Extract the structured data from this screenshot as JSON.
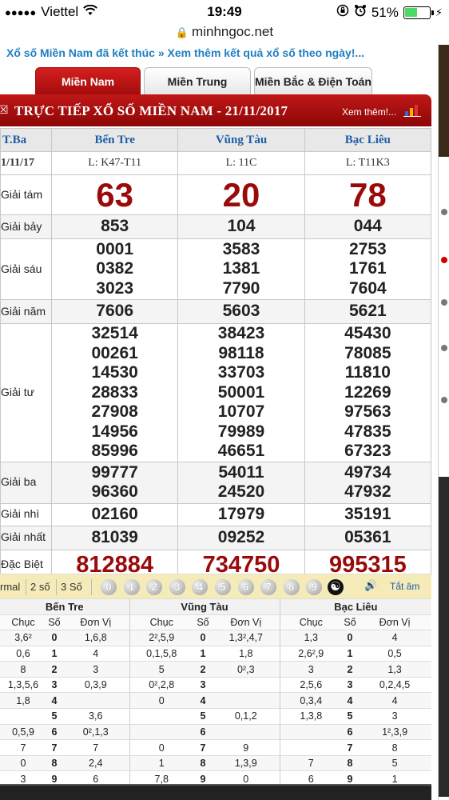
{
  "status_bar": {
    "signal_dots": "●●●●●",
    "carrier": "Viettel",
    "time": "19:49",
    "battery_percent": "51%",
    "battery_level": 0.51
  },
  "url_bar": {
    "domain": "minhngoc.net"
  },
  "marquee": "Xổ số Miền Nam đã kết thúc » Xem thêm kết quả xổ số theo ngày!...",
  "tabs": [
    {
      "label": "Miền Nam",
      "active": true
    },
    {
      "label": "Miền Trung",
      "active": false
    },
    {
      "label": "Miền Bắc & Điện Toán",
      "active": false
    }
  ],
  "header": {
    "title": "TRỰC TIẾP XỔ SỐ MIỀN NAM - 21/11/2017",
    "more_link": "Xem thêm!..."
  },
  "results": {
    "day": "T.Ba",
    "date": "1/11/17",
    "provinces": [
      {
        "name": "Bến Tre",
        "code": "L: K47-T11"
      },
      {
        "name": "Vũng Tàu",
        "code": "L: 11C"
      },
      {
        "name": "Bạc Liêu",
        "code": "L: T11K3"
      }
    ],
    "prizes": [
      {
        "label": "Giải tám",
        "values": [
          [
            "63"
          ],
          [
            "20"
          ],
          [
            "78"
          ]
        ]
      },
      {
        "label": "Giải bảy",
        "values": [
          [
            "853"
          ],
          [
            "104"
          ],
          [
            "044"
          ]
        ]
      },
      {
        "label": "Giải sáu",
        "values": [
          [
            "0001",
            "0382",
            "3023"
          ],
          [
            "3583",
            "1381",
            "7790"
          ],
          [
            "2753",
            "1761",
            "7604"
          ]
        ]
      },
      {
        "label": "Giải năm",
        "values": [
          [
            "7606"
          ],
          [
            "5603"
          ],
          [
            "5621"
          ]
        ]
      },
      {
        "label": "Giải tư",
        "values": [
          [
            "32514",
            "00261",
            "14530",
            "28833",
            "27908",
            "14956",
            "85996"
          ],
          [
            "38423",
            "98118",
            "33703",
            "50001",
            "10707",
            "79989",
            "46651"
          ],
          [
            "45430",
            "78085",
            "11810",
            "12269",
            "97563",
            "47835",
            "67323"
          ]
        ]
      },
      {
        "label": "Giải ba",
        "values": [
          [
            "99777",
            "96360"
          ],
          [
            "54011",
            "24520"
          ],
          [
            "49734",
            "47932"
          ]
        ]
      },
      {
        "label": "Giải nhì",
        "values": [
          [
            "02160"
          ],
          [
            "17979"
          ],
          [
            "35191"
          ]
        ]
      },
      {
        "label": "Giải nhất",
        "values": [
          [
            "81039"
          ],
          [
            "09252"
          ],
          [
            "05361"
          ]
        ]
      },
      {
        "label": "Đặc Biệt",
        "values": [
          [
            "812884"
          ],
          [
            "734750"
          ],
          [
            "995315"
          ]
        ]
      }
    ]
  },
  "selector": {
    "options": [
      "rmal",
      "2 số",
      "3 Số"
    ],
    "digits": [
      "0",
      "1",
      "2",
      "3",
      "4",
      "5",
      "6",
      "7",
      "8",
      "9"
    ],
    "yin_yang": "☯",
    "speaker": "🔊",
    "mute_all": "Tắt âm"
  },
  "loto": {
    "provinces": [
      "Bến Tre",
      "Vũng Tàu",
      "Bạc Liêu"
    ],
    "headers": [
      "Chục",
      "Số",
      "Đơn Vị"
    ],
    "rows": [
      [
        "3,6²",
        "0",
        "1,6,8",
        "2²,5,9",
        "0",
        "1,3²,4,7",
        "1,3",
        "0",
        "4"
      ],
      [
        "0,6",
        "1",
        "4",
        "0,1,5,8",
        "1",
        "1,8",
        "2,6²,9",
        "1",
        "0,5"
      ],
      [
        "8",
        "2",
        "3",
        "5",
        "2",
        "0²,3",
        "3",
        "2",
        "1,3"
      ],
      [
        "1,3,5,6",
        "3",
        "0,3,9",
        "0²,2,8",
        "3",
        "",
        "2,5,6",
        "3",
        "0,2,4,5"
      ],
      [
        "1,8",
        "4",
        "",
        "0",
        "4",
        "",
        "0,3,4",
        "4",
        "4"
      ],
      [
        "",
        "5",
        "3,6",
        "",
        "5",
        "0,1,2",
        "1,3,8",
        "5",
        "3"
      ],
      [
        "0,5,9",
        "6",
        "0²,1,3",
        "",
        "6",
        "",
        "",
        "6",
        "1²,3,9"
      ],
      [
        "7",
        "7",
        "7",
        "0",
        "7",
        "9",
        "",
        "7",
        "8"
      ],
      [
        "0",
        "8",
        "2,4",
        "1",
        "8",
        "1,3,9",
        "7",
        "8",
        "5"
      ],
      [
        "3",
        "9",
        "6",
        "7,8",
        "9",
        "0",
        "6",
        "9",
        "1"
      ]
    ]
  }
}
